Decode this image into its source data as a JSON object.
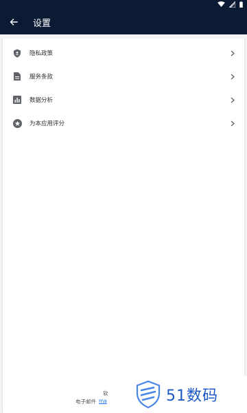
{
  "app_bar": {
    "title": "设置"
  },
  "menu": {
    "items": [
      {
        "label": "隐私政策",
        "icon": "shield-icon"
      },
      {
        "label": "服务条款",
        "icon": "document-icon"
      },
      {
        "label": "数据分析",
        "icon": "bar-chart-icon"
      },
      {
        "label": "为本应用评分",
        "icon": "star-circle-icon"
      }
    ]
  },
  "footer": {
    "software_partial": "软",
    "email_label": "电子邮件",
    "email_partial": "ma"
  },
  "watermark": {
    "text": "51数码"
  },
  "colors": {
    "app_bar_bg": "#0b1b33",
    "watermark_blue": "#1b58c9"
  }
}
